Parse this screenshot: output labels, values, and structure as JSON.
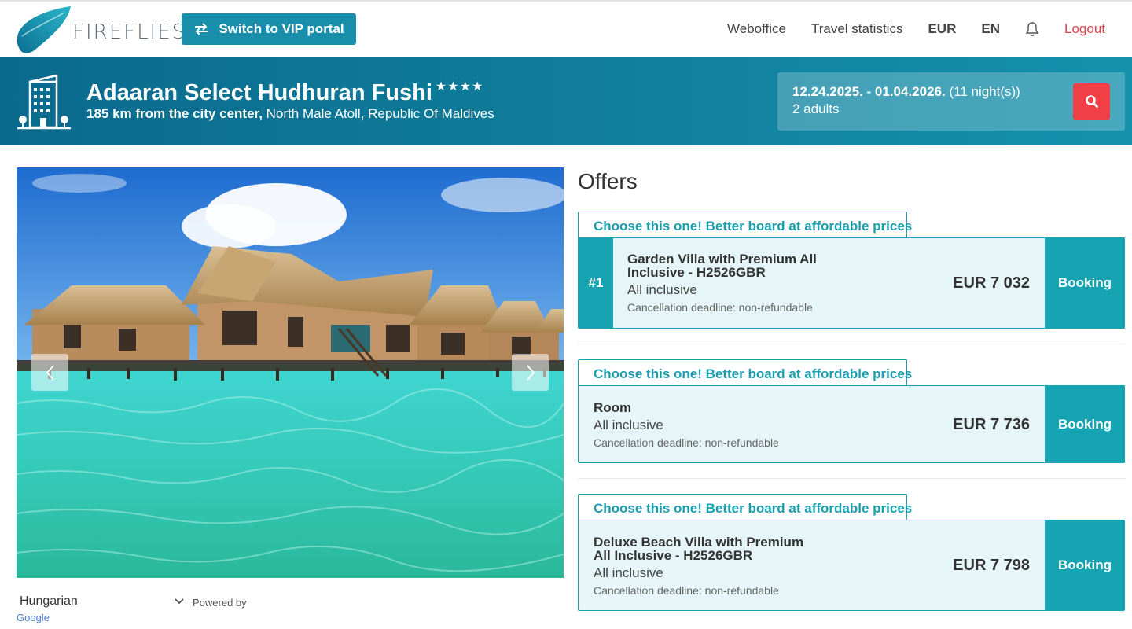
{
  "brand": {
    "name": "FIREFLIES"
  },
  "header": {
    "vip_button": "Switch to VIP portal",
    "nav": {
      "weboffice": "Weboffice",
      "travel_statistics": "Travel statistics",
      "currency": "EUR",
      "language": "EN",
      "logout": "Logout"
    }
  },
  "hotel": {
    "name": "Adaaran Select Hudhuran Fushi",
    "stars": "★★★★",
    "distance": "185 km from the city center,",
    "location": " North Male Atoll, Republic Of Maldives"
  },
  "search": {
    "dates": "12.24.2025. - 01.04.2026.",
    "nights": " (11 night(s))",
    "guests": "2 adults"
  },
  "translate": {
    "language": "Hungarian",
    "powered_by": "Powered by",
    "google": "Google"
  },
  "offers": {
    "title": "Offers",
    "items": [
      {
        "tag": "Choose this one! Better board at affordable prices",
        "rank": "#1",
        "room_line1": "Garden Villa with Premium All",
        "room_line2": "Inclusive - H2526GBR",
        "board": "All inclusive",
        "cancellation": "Cancellation deadline: non-refundable",
        "price": "EUR 7 032",
        "button": "Booking"
      },
      {
        "tag": "Choose this one! Better board at affordable prices",
        "room_line1": "Room",
        "board": "All inclusive",
        "cancellation": "Cancellation deadline: non-refundable",
        "price": "EUR 7 736",
        "button": "Booking"
      },
      {
        "tag": "Choose this one! Better board at affordable prices",
        "room_line1": "Deluxe Beach Villa with Premium",
        "room_line2": "All Inclusive - H2526GBR",
        "board": "All inclusive",
        "cancellation": "Cancellation deadline: non-refundable",
        "price": "EUR 7 798",
        "button": "Booking"
      }
    ]
  },
  "colors": {
    "brand_teal": "#1a8fac",
    "offer_teal": "#16a3b2",
    "search_red": "#f04046",
    "logout_red": "#e0444f"
  },
  "icons": [
    "logo-mark",
    "swap-icon",
    "bell-icon",
    "hotel-building-icon",
    "search-icon",
    "chevron-left-icon",
    "chevron-right-icon",
    "chevron-down-icon"
  ]
}
